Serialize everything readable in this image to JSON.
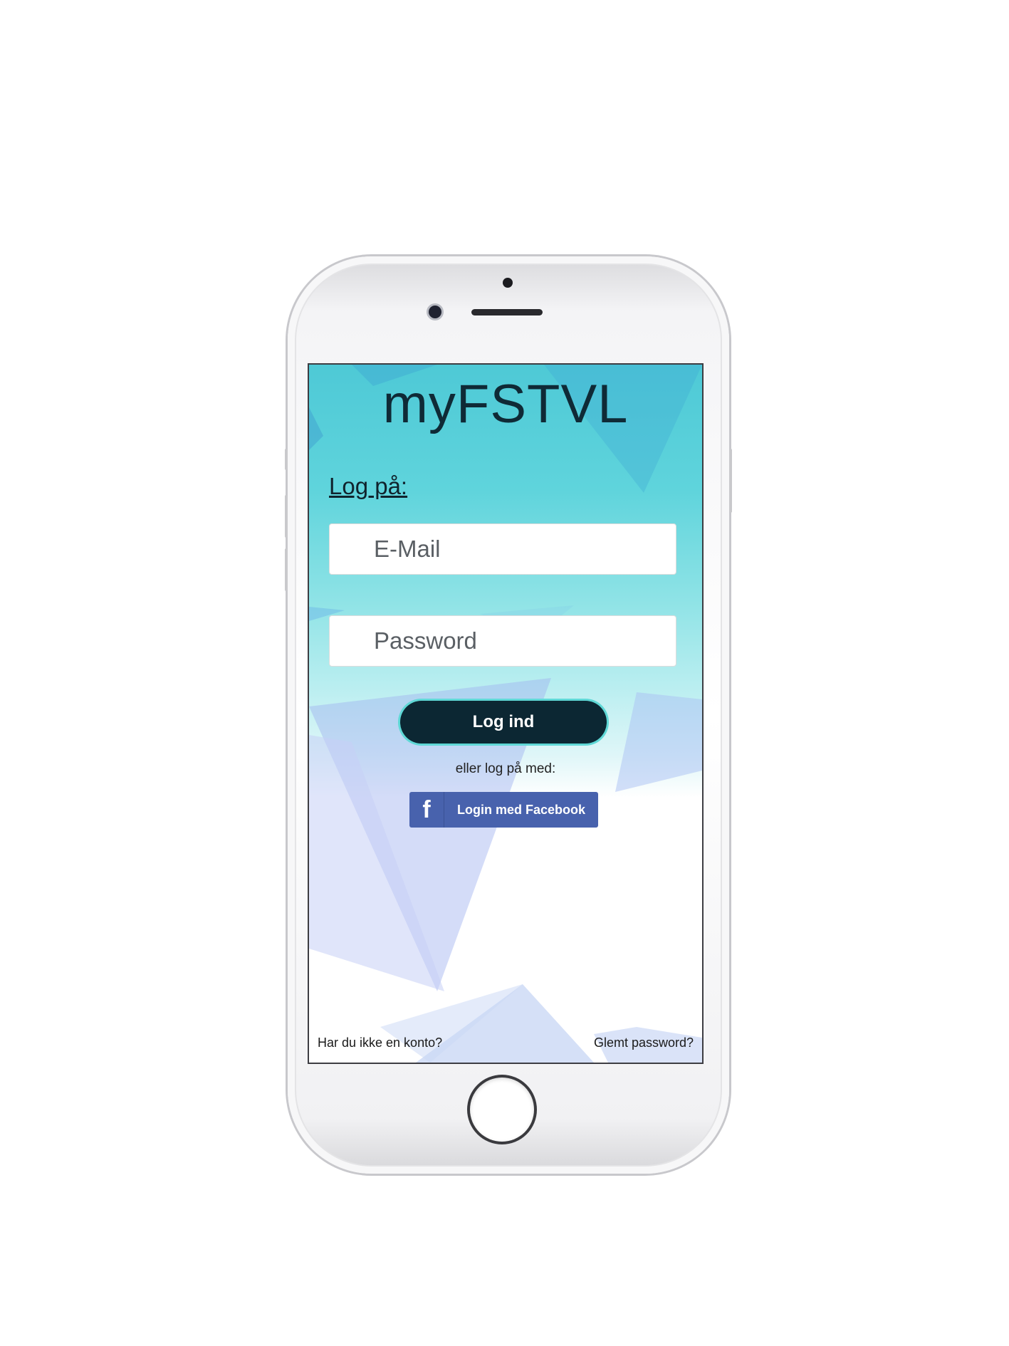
{
  "app": {
    "title": "myFSTVL"
  },
  "login": {
    "heading": "Log på:",
    "email_placeholder": "E-Mail",
    "password_placeholder": "Password",
    "login_button": "Log ind",
    "or_text": "eller log på med:",
    "facebook_button": "Login med Facebook",
    "facebook_icon": "facebook-f-icon"
  },
  "footer": {
    "signup_link": "Har du ikke en konto?",
    "forgot_link": "Glemt password?"
  },
  "colors": {
    "accent_teal": "#4ec9d6",
    "button_dark": "#0c2733",
    "facebook_blue": "#4862ad"
  }
}
